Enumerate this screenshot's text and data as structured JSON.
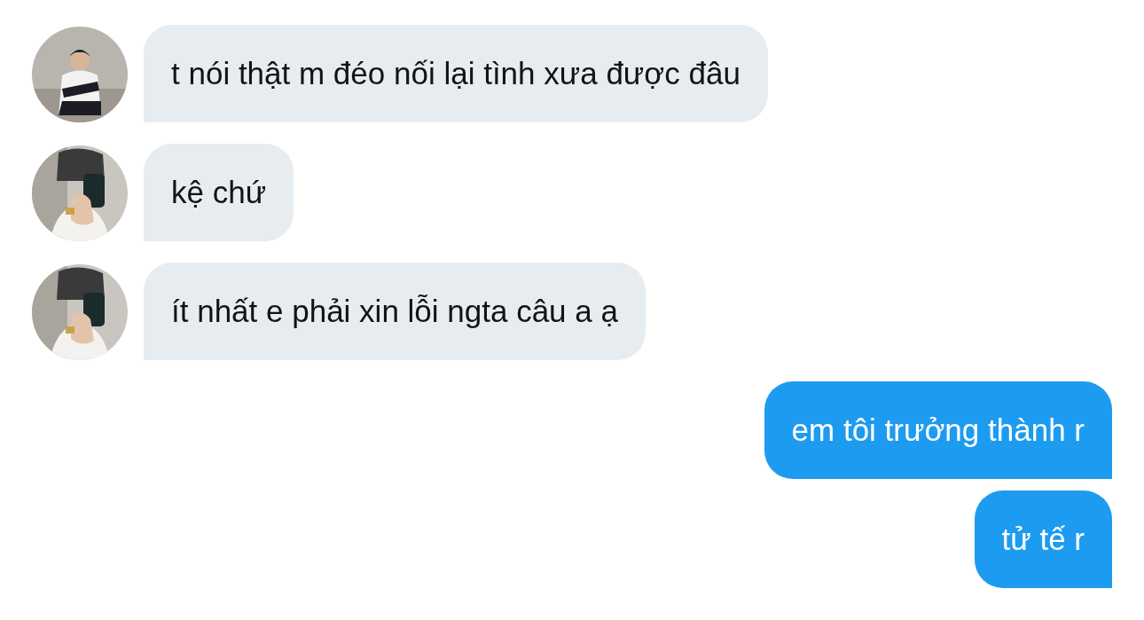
{
  "messages": [
    {
      "kind": "received",
      "text": "t nói thật m đéo nối lại tình xưa được đâu"
    },
    {
      "kind": "received",
      "text": "kệ chứ"
    },
    {
      "kind": "received",
      "text": "ít nhất e phải xin lỗi ngta câu a ạ"
    },
    {
      "kind": "sent",
      "text": "em tôi trưởng thành r"
    },
    {
      "kind": "sent",
      "text": "tử tế r"
    }
  ]
}
